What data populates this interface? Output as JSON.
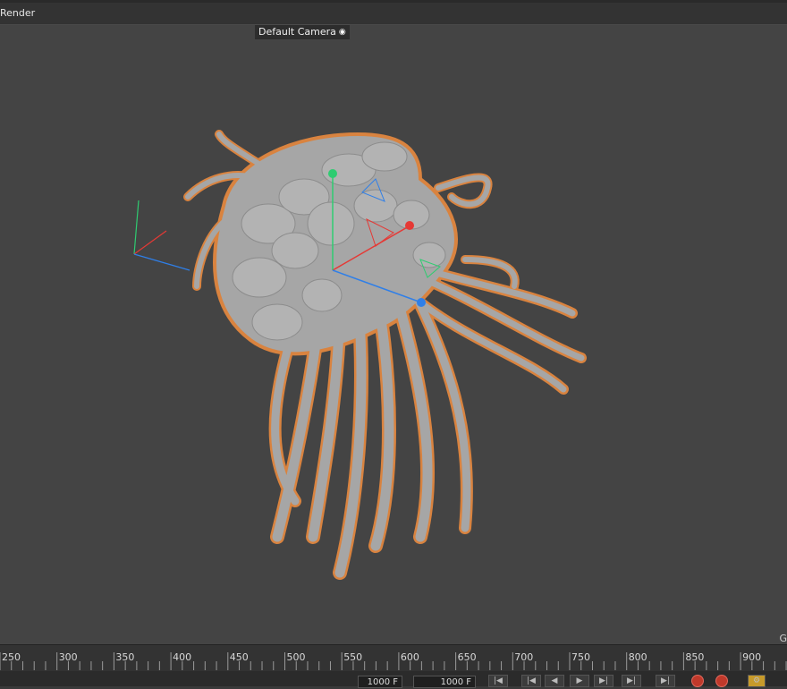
{
  "menubar": {
    "render_label": "Render"
  },
  "viewport": {
    "camera_label": "Default Camera",
    "corner_letter": "G"
  },
  "timeline": {
    "ticks": [
      "250",
      "300",
      "350",
      "400",
      "450",
      "500",
      "550",
      "600",
      "650",
      "700",
      "750",
      "800",
      "850",
      "900"
    ],
    "start_field": "1000 F",
    "end_field": "1000 F"
  },
  "colors": {
    "viewport_bg": "#444444",
    "model": "#a8a8a8",
    "selection_outline": "#d9833f",
    "axis_x": "#e53935",
    "axis_y": "#2ecc71",
    "axis_z": "#2f7fe8"
  },
  "icons": {
    "camera": "camera-icon",
    "first_frame": "go-to-start-icon",
    "prev_key": "previous-key-icon",
    "prev_frame": "previous-frame-icon",
    "play": "play-icon",
    "next_frame": "next-frame-icon",
    "next_key": "next-key-icon",
    "last_frame": "go-to-end-icon",
    "record": "record-icon",
    "autokey": "autokey-icon"
  }
}
